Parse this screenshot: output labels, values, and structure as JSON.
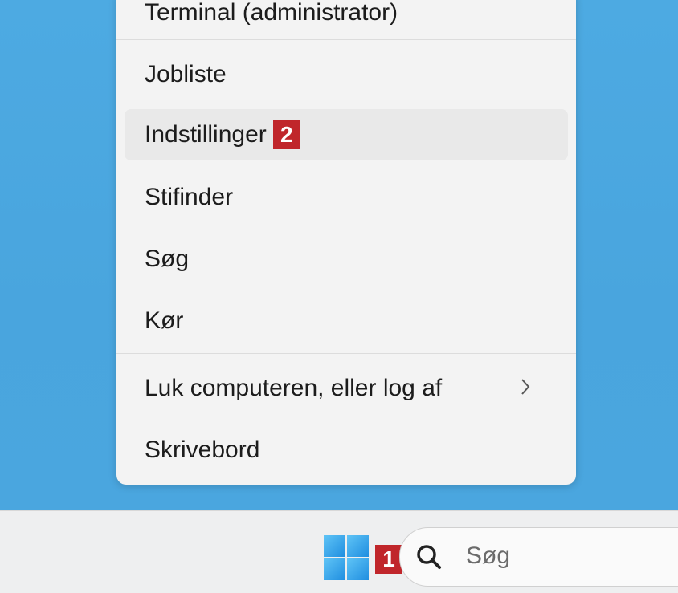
{
  "context_menu": {
    "items": [
      {
        "label": "Terminal (administrator)"
      },
      {
        "label": "Jobliste"
      },
      {
        "label": "Indstillinger",
        "badge": "2"
      },
      {
        "label": "Stifinder"
      },
      {
        "label": "Søg"
      },
      {
        "label": "Kør"
      },
      {
        "label": "Luk computeren, eller log af",
        "submenu_icon": "chevron-right-icon"
      },
      {
        "label": "Skrivebord"
      }
    ]
  },
  "taskbar": {
    "start_icon": "windows-logo-icon",
    "badge": "1",
    "search": {
      "placeholder": "Søg",
      "icon": "search-icon"
    }
  },
  "colors": {
    "desktop": "#4aa8e0",
    "menu_bg": "#f3f3f3",
    "hover_bg": "#e9e9e9",
    "badge": "#c0262b",
    "taskbar": "#eeeff0"
  }
}
